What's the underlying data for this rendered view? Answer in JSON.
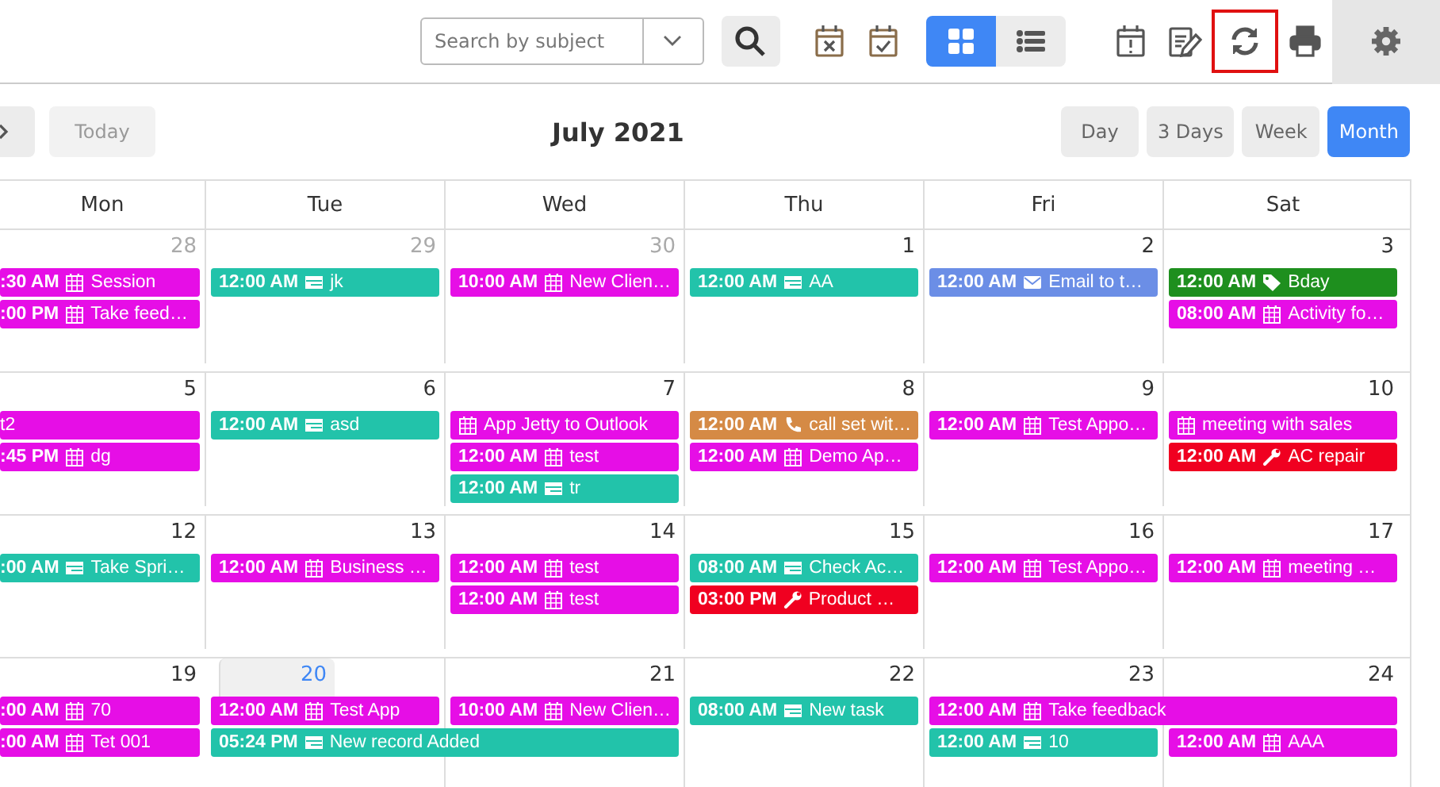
{
  "toolbar": {
    "search": {
      "placeholder": "Search by subject"
    },
    "icons": [
      {
        "kind": "calendar-x",
        "highlighted": false
      },
      {
        "kind": "calendar-check",
        "highlighted": false
      }
    ],
    "layout_toggle": [
      {
        "kind": "grid",
        "selected": true
      },
      {
        "kind": "list",
        "selected": false
      }
    ],
    "actions": [
      {
        "kind": "calendar-alert",
        "highlighted": false
      },
      {
        "kind": "notes-edit",
        "highlighted": false
      },
      {
        "kind": "refresh",
        "highlighted": true
      },
      {
        "kind": "print",
        "highlighted": false
      }
    ]
  },
  "nav": {
    "today": "Today",
    "title": "July 2021",
    "views": [
      {
        "label": "Day",
        "selected": false
      },
      {
        "label": "3 Days",
        "selected": false
      },
      {
        "label": "Week",
        "selected": false
      },
      {
        "label": "Month",
        "selected": true
      }
    ]
  },
  "weekdays": [
    "Mon",
    "Tue",
    "Wed",
    "Thu",
    "Fri",
    "Sat"
  ],
  "weeks": [
    {
      "days": [
        {
          "number": "28",
          "other_month": true,
          "today": false,
          "events": [
            {
              "time": ":30 AM",
              "title": "Session",
              "kind": "appointment",
              "color": "#e60ee6"
            },
            {
              "time": ":00 PM",
              "title": "Take feed…",
              "kind": "appointment",
              "color": "#e60ee6"
            }
          ]
        },
        {
          "number": "29",
          "other_month": true,
          "today": false,
          "events": [
            {
              "time": "12:00 AM",
              "title": "jk",
              "kind": "task",
              "color": "#22c3aa"
            }
          ]
        },
        {
          "number": "30",
          "other_month": true,
          "today": false,
          "events": [
            {
              "time": "10:00 AM",
              "title": "New Clien…",
              "kind": "appointment",
              "color": "#e60ee6"
            }
          ]
        },
        {
          "number": "1",
          "other_month": false,
          "today": false,
          "events": [
            {
              "time": "12:00 AM",
              "title": "AA",
              "kind": "task",
              "color": "#22c3aa"
            }
          ]
        },
        {
          "number": "2",
          "other_month": false,
          "today": false,
          "events": [
            {
              "time": "12:00 AM",
              "title": "Email to t…",
              "kind": "email",
              "color": "#6b8ee6"
            }
          ]
        },
        {
          "number": "3",
          "other_month": false,
          "today": false,
          "events": [
            {
              "time": "12:00 AM",
              "title": "Bday",
              "kind": "tag",
              "color": "#1e8f1e"
            },
            {
              "time": "08:00 AM",
              "title": "Activity fo…",
              "kind": "appointment",
              "color": "#e60ee6"
            }
          ]
        }
      ]
    },
    {
      "days": [
        {
          "number": "5",
          "other_month": false,
          "today": false,
          "events": [
            {
              "title": "t2",
              "kind": "plain",
              "color": "#e60ee6"
            },
            {
              "time": ":45 PM",
              "title": "dg",
              "kind": "appointment",
              "color": "#e60ee6"
            }
          ]
        },
        {
          "number": "6",
          "other_month": false,
          "today": false,
          "events": [
            {
              "time": "12:00 AM",
              "title": "asd",
              "kind": "task",
              "color": "#22c3aa"
            }
          ]
        },
        {
          "number": "7",
          "other_month": false,
          "today": false,
          "events": [
            {
              "title": "App Jetty to Outlook",
              "kind": "appointment",
              "color": "#e60ee6"
            },
            {
              "time": "12:00 AM",
              "title": "test",
              "kind": "appointment",
              "color": "#e60ee6"
            },
            {
              "time": "12:00 AM",
              "title": "tr",
              "kind": "task",
              "color": "#22c3aa"
            }
          ]
        },
        {
          "number": "8",
          "other_month": false,
          "today": false,
          "events": [
            {
              "time": "12:00 AM",
              "title": "call set wit…",
              "kind": "phone",
              "color": "#d58a45"
            },
            {
              "time": "12:00 AM",
              "title": "Demo Ap…",
              "kind": "appointment",
              "color": "#e60ee6"
            }
          ]
        },
        {
          "number": "9",
          "other_month": false,
          "today": false,
          "events": [
            {
              "time": "12:00 AM",
              "title": "Test Appo…",
              "kind": "appointment",
              "color": "#e60ee6"
            }
          ]
        },
        {
          "number": "10",
          "other_month": false,
          "today": false,
          "events": [
            {
              "title": "meeting with sales",
              "kind": "appointment",
              "color": "#e60ee6"
            },
            {
              "time": "12:00 AM",
              "title": "AC repair",
              "kind": "repair",
              "color": "#f00020"
            }
          ]
        }
      ]
    },
    {
      "days": [
        {
          "number": "12",
          "other_month": false,
          "today": false,
          "events": [
            {
              "time": ":00 AM",
              "title": "Take Spri…",
              "kind": "task",
              "color": "#22c3aa"
            }
          ]
        },
        {
          "number": "13",
          "other_month": false,
          "today": false,
          "events": [
            {
              "time": "12:00 AM",
              "title": "Business …",
              "kind": "appointment",
              "color": "#e60ee6"
            }
          ]
        },
        {
          "number": "14",
          "other_month": false,
          "today": false,
          "events": [
            {
              "time": "12:00 AM",
              "title": "test",
              "kind": "appointment",
              "color": "#e60ee6"
            },
            {
              "time": "12:00 AM",
              "title": "test",
              "kind": "appointment",
              "color": "#e60ee6"
            }
          ]
        },
        {
          "number": "15",
          "other_month": false,
          "today": false,
          "events": [
            {
              "time": "08:00 AM",
              "title": "Check Ac…",
              "kind": "task",
              "color": "#22c3aa"
            },
            {
              "time": "03:00 PM",
              "title": "Product …",
              "kind": "repair",
              "color": "#f00020"
            }
          ]
        },
        {
          "number": "16",
          "other_month": false,
          "today": false,
          "events": [
            {
              "time": "12:00 AM",
              "title": "Test Appo…",
              "kind": "appointment",
              "color": "#e60ee6"
            }
          ]
        },
        {
          "number": "17",
          "other_month": false,
          "today": false,
          "events": [
            {
              "time": "12:00 AM",
              "title": "meeting …",
              "kind": "appointment",
              "color": "#e60ee6"
            }
          ]
        }
      ]
    },
    {
      "days": [
        {
          "number": "19",
          "other_month": false,
          "today": false,
          "events": [
            {
              "time": ":00 AM",
              "title": "70",
              "kind": "appointment",
              "color": "#e60ee6"
            },
            {
              "time": ":00 AM",
              "title": "Tet 001",
              "kind": "appointment",
              "color": "#e60ee6"
            }
          ]
        },
        {
          "number": "20",
          "other_month": false,
          "today": true,
          "events": [
            {
              "time": "12:00 AM",
              "title": "Test App",
              "kind": "appointment",
              "color": "#e60ee6"
            },
            {
              "time": "05:24 PM",
              "title": "New record Added",
              "kind": "task",
              "color": "#22c3aa",
              "spans_next_day": true
            }
          ]
        },
        {
          "number": "21",
          "other_month": false,
          "today": false,
          "events": [
            {
              "time": "10:00 AM",
              "title": "New Clien…",
              "kind": "appointment",
              "color": "#e60ee6"
            }
          ]
        },
        {
          "number": "22",
          "other_month": false,
          "today": false,
          "events": [
            {
              "time": "08:00 AM",
              "title": "New task",
              "kind": "task",
              "color": "#22c3aa"
            }
          ]
        },
        {
          "number": "23",
          "other_month": false,
          "today": false,
          "events": [
            {
              "time": "12:00 AM",
              "title": "Take feedback",
              "kind": "appointment",
              "color": "#e60ee6",
              "spans_next_day": true
            },
            {
              "time": "12:00 AM",
              "title": "10",
              "kind": "task",
              "color": "#22c3aa"
            }
          ]
        },
        {
          "number": "24",
          "other_month": false,
          "today": false,
          "events": [
            {
              "time": "12:00 AM",
              "title": "AAA",
              "kind": "appointment",
              "color": "#e60ee6"
            }
          ]
        }
      ]
    }
  ]
}
